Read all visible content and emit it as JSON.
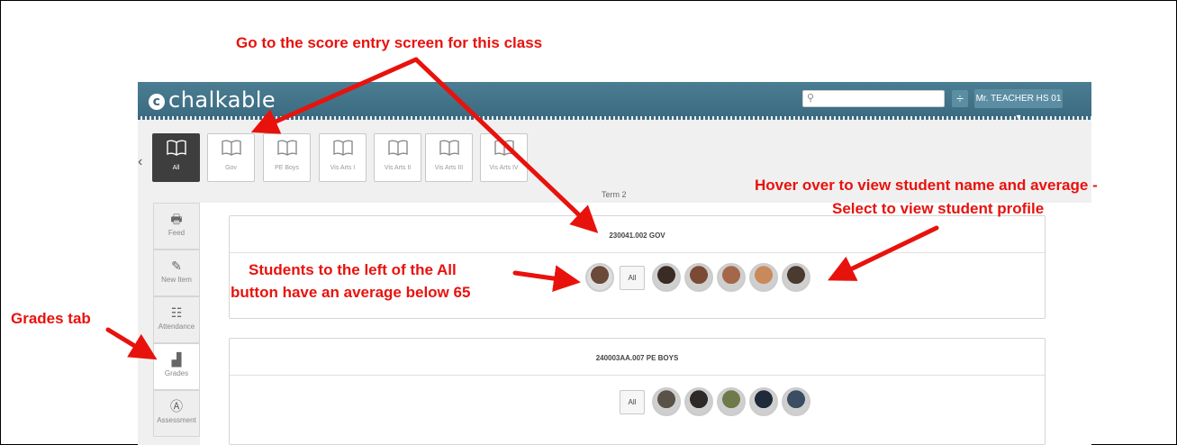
{
  "annotations": {
    "score_entry": "Go to the score entry screen for this class",
    "hover_line1": "Hover over to view student name and average -",
    "hover_line2": "Select to view student profile",
    "students_line1": "Students to the left of the All",
    "students_line2": "button have an average below 65",
    "grades_tab": "Grades tab"
  },
  "header": {
    "logo": "chalkable",
    "logo_mark": "c",
    "search_placeholder": "",
    "divider_icon": "÷",
    "user_label": "Mr. TEACHER HS 01 ▾"
  },
  "classes": [
    {
      "label": "All",
      "active": true
    },
    {
      "label": "Gov"
    },
    {
      "label": "PE Boys"
    },
    {
      "label": "Vis Arts I"
    },
    {
      "label": "Vis Arts II"
    },
    {
      "label": "Vis Arts III"
    },
    {
      "label": "Vis Arts IV"
    }
  ],
  "term": "Term 2",
  "nav": [
    {
      "label": "Feed",
      "icon": "🖶"
    },
    {
      "label": "New Item",
      "icon": "✎"
    },
    {
      "label": "Attendance",
      "icon": "☷"
    },
    {
      "label": "Grades",
      "icon": "▟"
    },
    {
      "label": "Assessment",
      "icon": "Ⓐ"
    }
  ],
  "cards": [
    {
      "title": "230041.002 GOV",
      "all_label": "All",
      "below": [
        {
          "color": "#6b4a3a"
        }
      ],
      "above": [
        {
          "color": "#3a2b25"
        },
        {
          "color": "#7a4a35"
        },
        {
          "color": "#a4674a"
        },
        {
          "color": "#c88a5a"
        },
        {
          "color": "#4a3a30"
        }
      ]
    },
    {
      "title": "240003AA.007 PE BOYS",
      "all_label": "All",
      "below": [],
      "above": [
        {
          "color": "#5a5148"
        },
        {
          "color": "#2e2a28"
        },
        {
          "color": "#6f7a4a"
        },
        {
          "color": "#1f2a3a"
        },
        {
          "color": "#3b4d62"
        }
      ]
    }
  ]
}
